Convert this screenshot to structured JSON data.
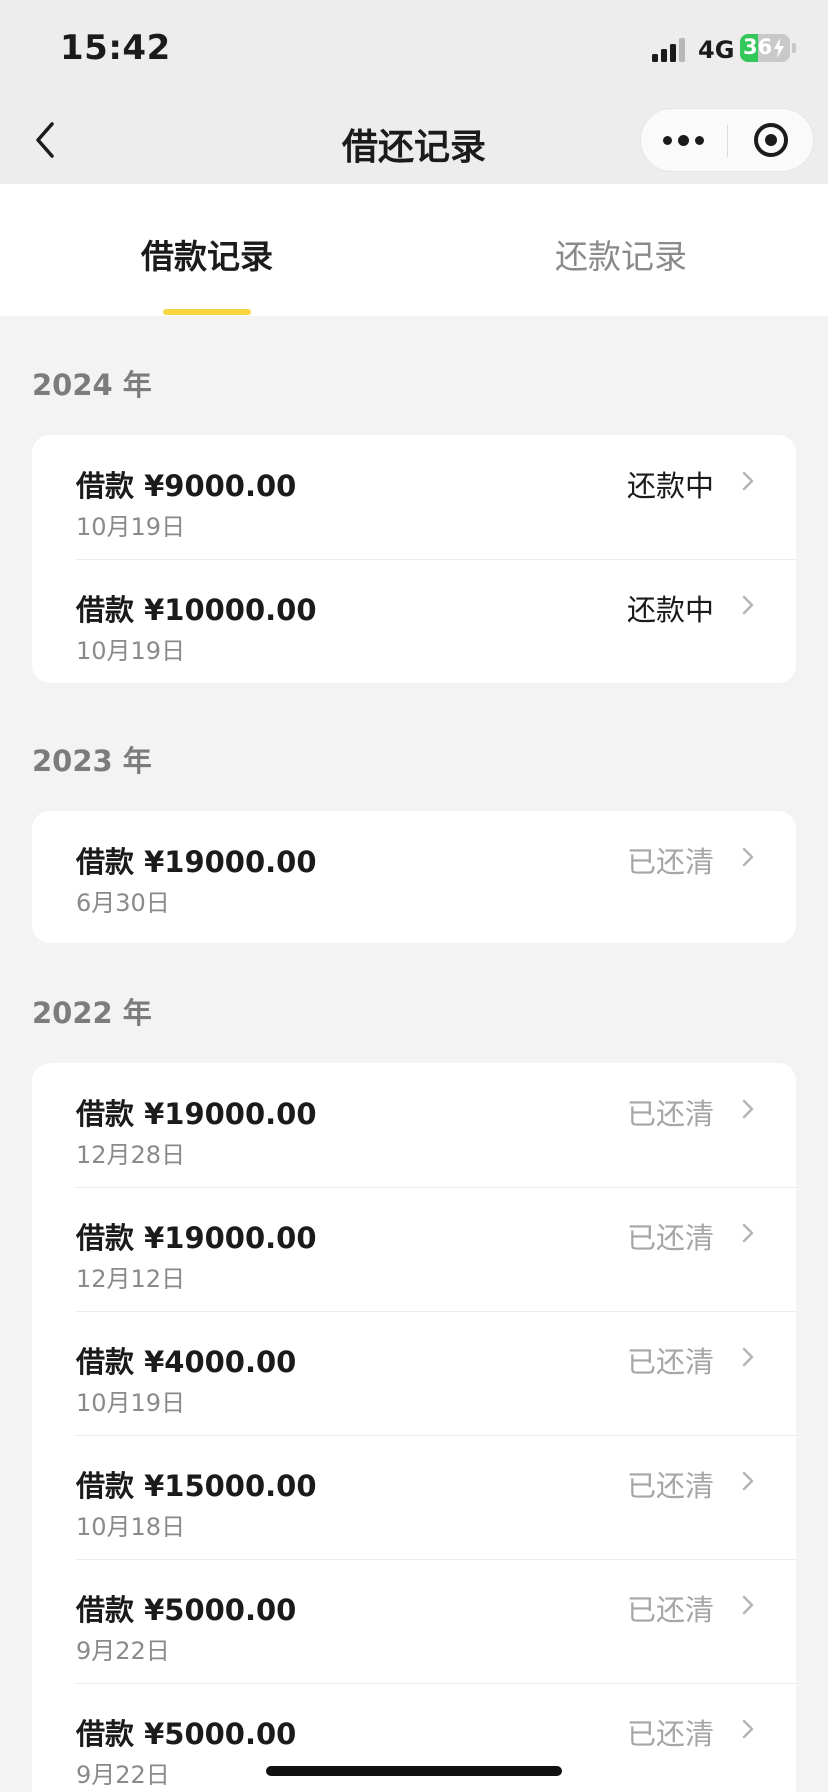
{
  "status_bar": {
    "time": "15:42",
    "network": "4G",
    "battery_level": 36,
    "battery_label": "36"
  },
  "nav": {
    "title": "借还记录",
    "back_icon": "chevron-left-icon",
    "more_icon": "more-dots-icon",
    "close_icon": "mini-program-close-icon"
  },
  "tabs": [
    {
      "label": "借款记录",
      "active": true
    },
    {
      "label": "还款记录",
      "active": false
    }
  ],
  "accent_color": "#f8d442",
  "sections": [
    {
      "year": "2024 年",
      "records": [
        {
          "amount": "借款 ¥9000.00",
          "date": "10月19日",
          "status": "还款中",
          "state": "active"
        },
        {
          "amount": "借款 ¥10000.00",
          "date": "10月19日",
          "status": "还款中",
          "state": "active"
        }
      ]
    },
    {
      "year": "2023 年",
      "records": [
        {
          "amount": "借款 ¥19000.00",
          "date": "6月30日",
          "status": "已还清",
          "state": "done"
        }
      ]
    },
    {
      "year": "2022 年",
      "records": [
        {
          "amount": "借款 ¥19000.00",
          "date": "12月28日",
          "status": "已还清",
          "state": "done"
        },
        {
          "amount": "借款 ¥19000.00",
          "date": "12月12日",
          "status": "已还清",
          "state": "done"
        },
        {
          "amount": "借款 ¥4000.00",
          "date": "10月19日",
          "status": "已还清",
          "state": "done"
        },
        {
          "amount": "借款 ¥15000.00",
          "date": "10月18日",
          "status": "已还清",
          "state": "done"
        },
        {
          "amount": "借款 ¥5000.00",
          "date": "9月22日",
          "status": "已还清",
          "state": "done"
        },
        {
          "amount": "借款 ¥5000.00",
          "date": "9月22日",
          "status": "已还清",
          "state": "done"
        }
      ]
    }
  ]
}
